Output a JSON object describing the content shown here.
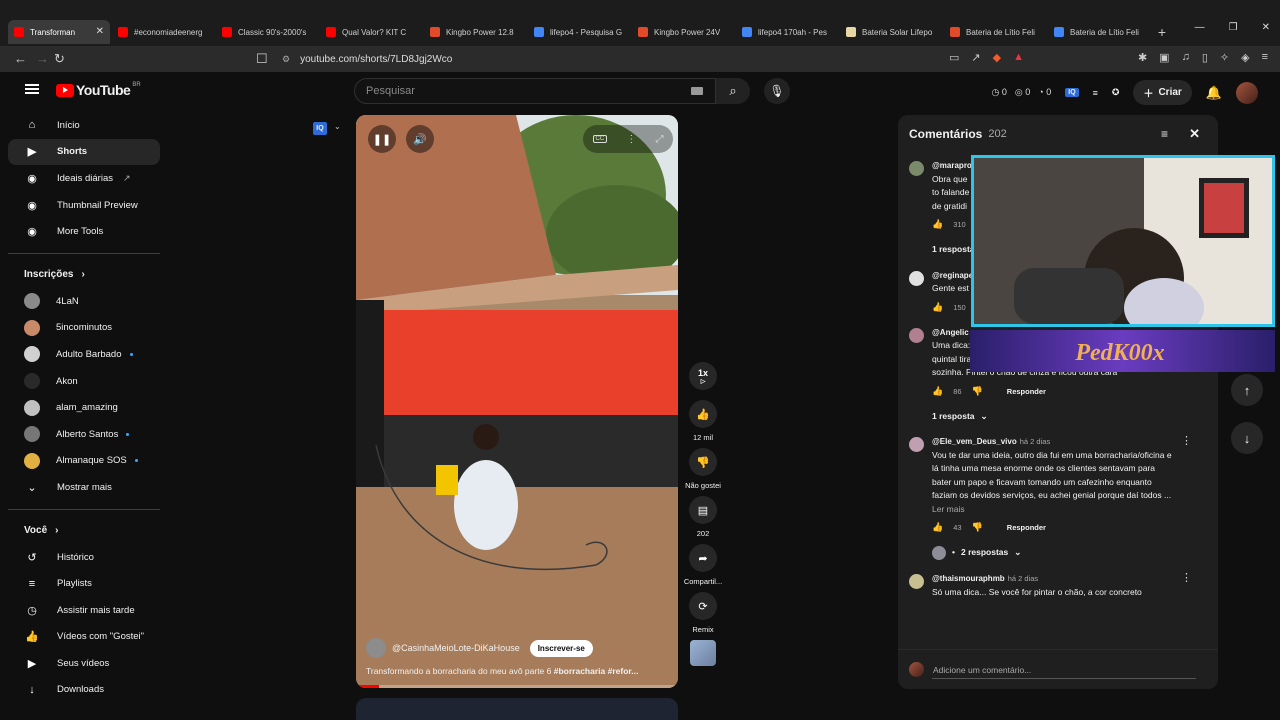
{
  "browser": {
    "tabs": [
      {
        "label": "Transforman",
        "color": "#ff0000",
        "active": true
      },
      {
        "label": "#economiadeenerg",
        "color": "#ff0000"
      },
      {
        "label": "Classic 90's-2000's",
        "color": "#ff0000"
      },
      {
        "label": "Qual Valor? KIT C",
        "color": "#ff0000"
      },
      {
        "label": "Kingbo Power 12.8",
        "color": "#e24a2a"
      },
      {
        "label": "lifepo4 - Pesquisa G",
        "color": "#4285f4"
      },
      {
        "label": "Kingbo Power 24V",
        "color": "#e24a2a"
      },
      {
        "label": "lifepo4 170ah - Pes",
        "color": "#4285f4"
      },
      {
        "label": "Bateria Solar Lifepo",
        "color": "#e8d7a5"
      },
      {
        "label": "Bateria de Lítio Feli",
        "color": "#e24a2a"
      },
      {
        "label": "Bateria de Lítio Feli",
        "color": "#4285f4"
      }
    ],
    "url": "youtube.com/shorts/7LD8Jgj2Wco"
  },
  "header": {
    "logo_text": "YouTube",
    "region": "BR",
    "search_placeholder": "Pesquisar",
    "counters": [
      "0",
      "0",
      "0"
    ],
    "create_label": "Criar"
  },
  "sidebar": {
    "main": [
      {
        "label": "Início",
        "icon": "home-icon",
        "glyph": "⌂"
      },
      {
        "label": "Shorts",
        "icon": "shorts-icon",
        "glyph": "▶"
      },
      {
        "label": "Ideais diárias",
        "icon": "extension-icon",
        "glyph": "◉"
      },
      {
        "label": "Thumbnail Preview",
        "icon": "extension-icon",
        "glyph": "◉"
      },
      {
        "label": "More Tools",
        "icon": "extension-icon",
        "glyph": "◉"
      }
    ],
    "subs_title": "Inscrições",
    "subscriptions": [
      {
        "label": "4LaN",
        "color": "#8a8a8a"
      },
      {
        "label": "5incominutos",
        "color": "#c98a6a"
      },
      {
        "label": "Adulto Barbado",
        "color": "#d0d0d0"
      },
      {
        "label": "Akon",
        "color": "#2a2a2a"
      },
      {
        "label": "alam_amazing",
        "color": "#c0c0c0"
      },
      {
        "label": "Alberto Santos",
        "color": "#777777"
      },
      {
        "label": "Almanaque SOS",
        "color": "#e0b040"
      }
    ],
    "show_more": "Mostrar mais",
    "you_title": "Você",
    "you": [
      {
        "label": "Histórico",
        "glyph": "↺",
        "icon": "history-icon"
      },
      {
        "label": "Playlists",
        "glyph": "≡",
        "icon": "playlist-icon"
      },
      {
        "label": "Assistir mais tarde",
        "glyph": "◷",
        "icon": "clock-icon"
      },
      {
        "label": "Vídeos com \"Gostei\"",
        "glyph": "👍",
        "icon": "like-icon"
      },
      {
        "label": "Seus vídeos",
        "glyph": "▶",
        "icon": "video-icon"
      },
      {
        "label": "Downloads",
        "glyph": "↓",
        "icon": "download-icon"
      }
    ]
  },
  "video": {
    "channel": "@CasinhaMeioLote-DiKaHouse",
    "subscribe": "Inscrever-se",
    "caption": "Transformando a borracharia do meu avô parte 6",
    "hashtags": "#borracharia #refor...",
    "progress": 0.07
  },
  "actions": {
    "speed": "1x",
    "likes": "12 mil",
    "dislike": "Não gostei",
    "comments": "202",
    "share": "Compartil...",
    "remix": "Remix"
  },
  "comments": {
    "title": "Comentários",
    "count": "202",
    "items": [
      {
        "user": "@marapro",
        "time": "",
        "text": [
          "Obra que",
          "to falande",
          "de gratidi"
        ],
        "likes": "310",
        "replies": "1 resposta",
        "color": "#7a8a6a"
      },
      {
        "user": "@reginape",
        "time": "",
        "text": [
          "Gente est"
        ],
        "likes": "150",
        "replies": "",
        "color": "#e0e0e0"
      },
      {
        "user": "@Angelic",
        "time": "",
        "text": [
          "Uma dica:",
          "quintal tirava todo o brilho da pitangueira e dos canteiros que fiz",
          "sozinha. Pintei o chão de cinza e ficou outra cara"
        ],
        "likes": "86",
        "replies": "1 resposta",
        "color": "#b08090"
      },
      {
        "user": "@Ele_vem_Deus_vivo",
        "time": "há 2 dias",
        "text": [
          "Vou te dar uma ideia, outro dia fui em uma borracharia/oficina e",
          "lá tinha uma mesa enorme onde os clientes sentavam para",
          "bater um papo e ficavam tomando um cafezinho enquanto",
          "faziam os devidos serviços, eu achei genial porque daí todos ..."
        ],
        "more": "Ler mais",
        "likes": "43",
        "replies": "2 respostas",
        "color": "#c0a0b0"
      },
      {
        "user": "@thaismouraphmb",
        "time": "há 2 dias",
        "text": [
          "Só uma dica... Se você for pintar o chão, a cor concreto"
        ],
        "likes": "",
        "replies": "",
        "color": "#c8c090"
      }
    ],
    "reply_label": "Responder",
    "add_placeholder": "Adicione um comentário..."
  },
  "overlay": {
    "brand_text": "PedK00x"
  }
}
